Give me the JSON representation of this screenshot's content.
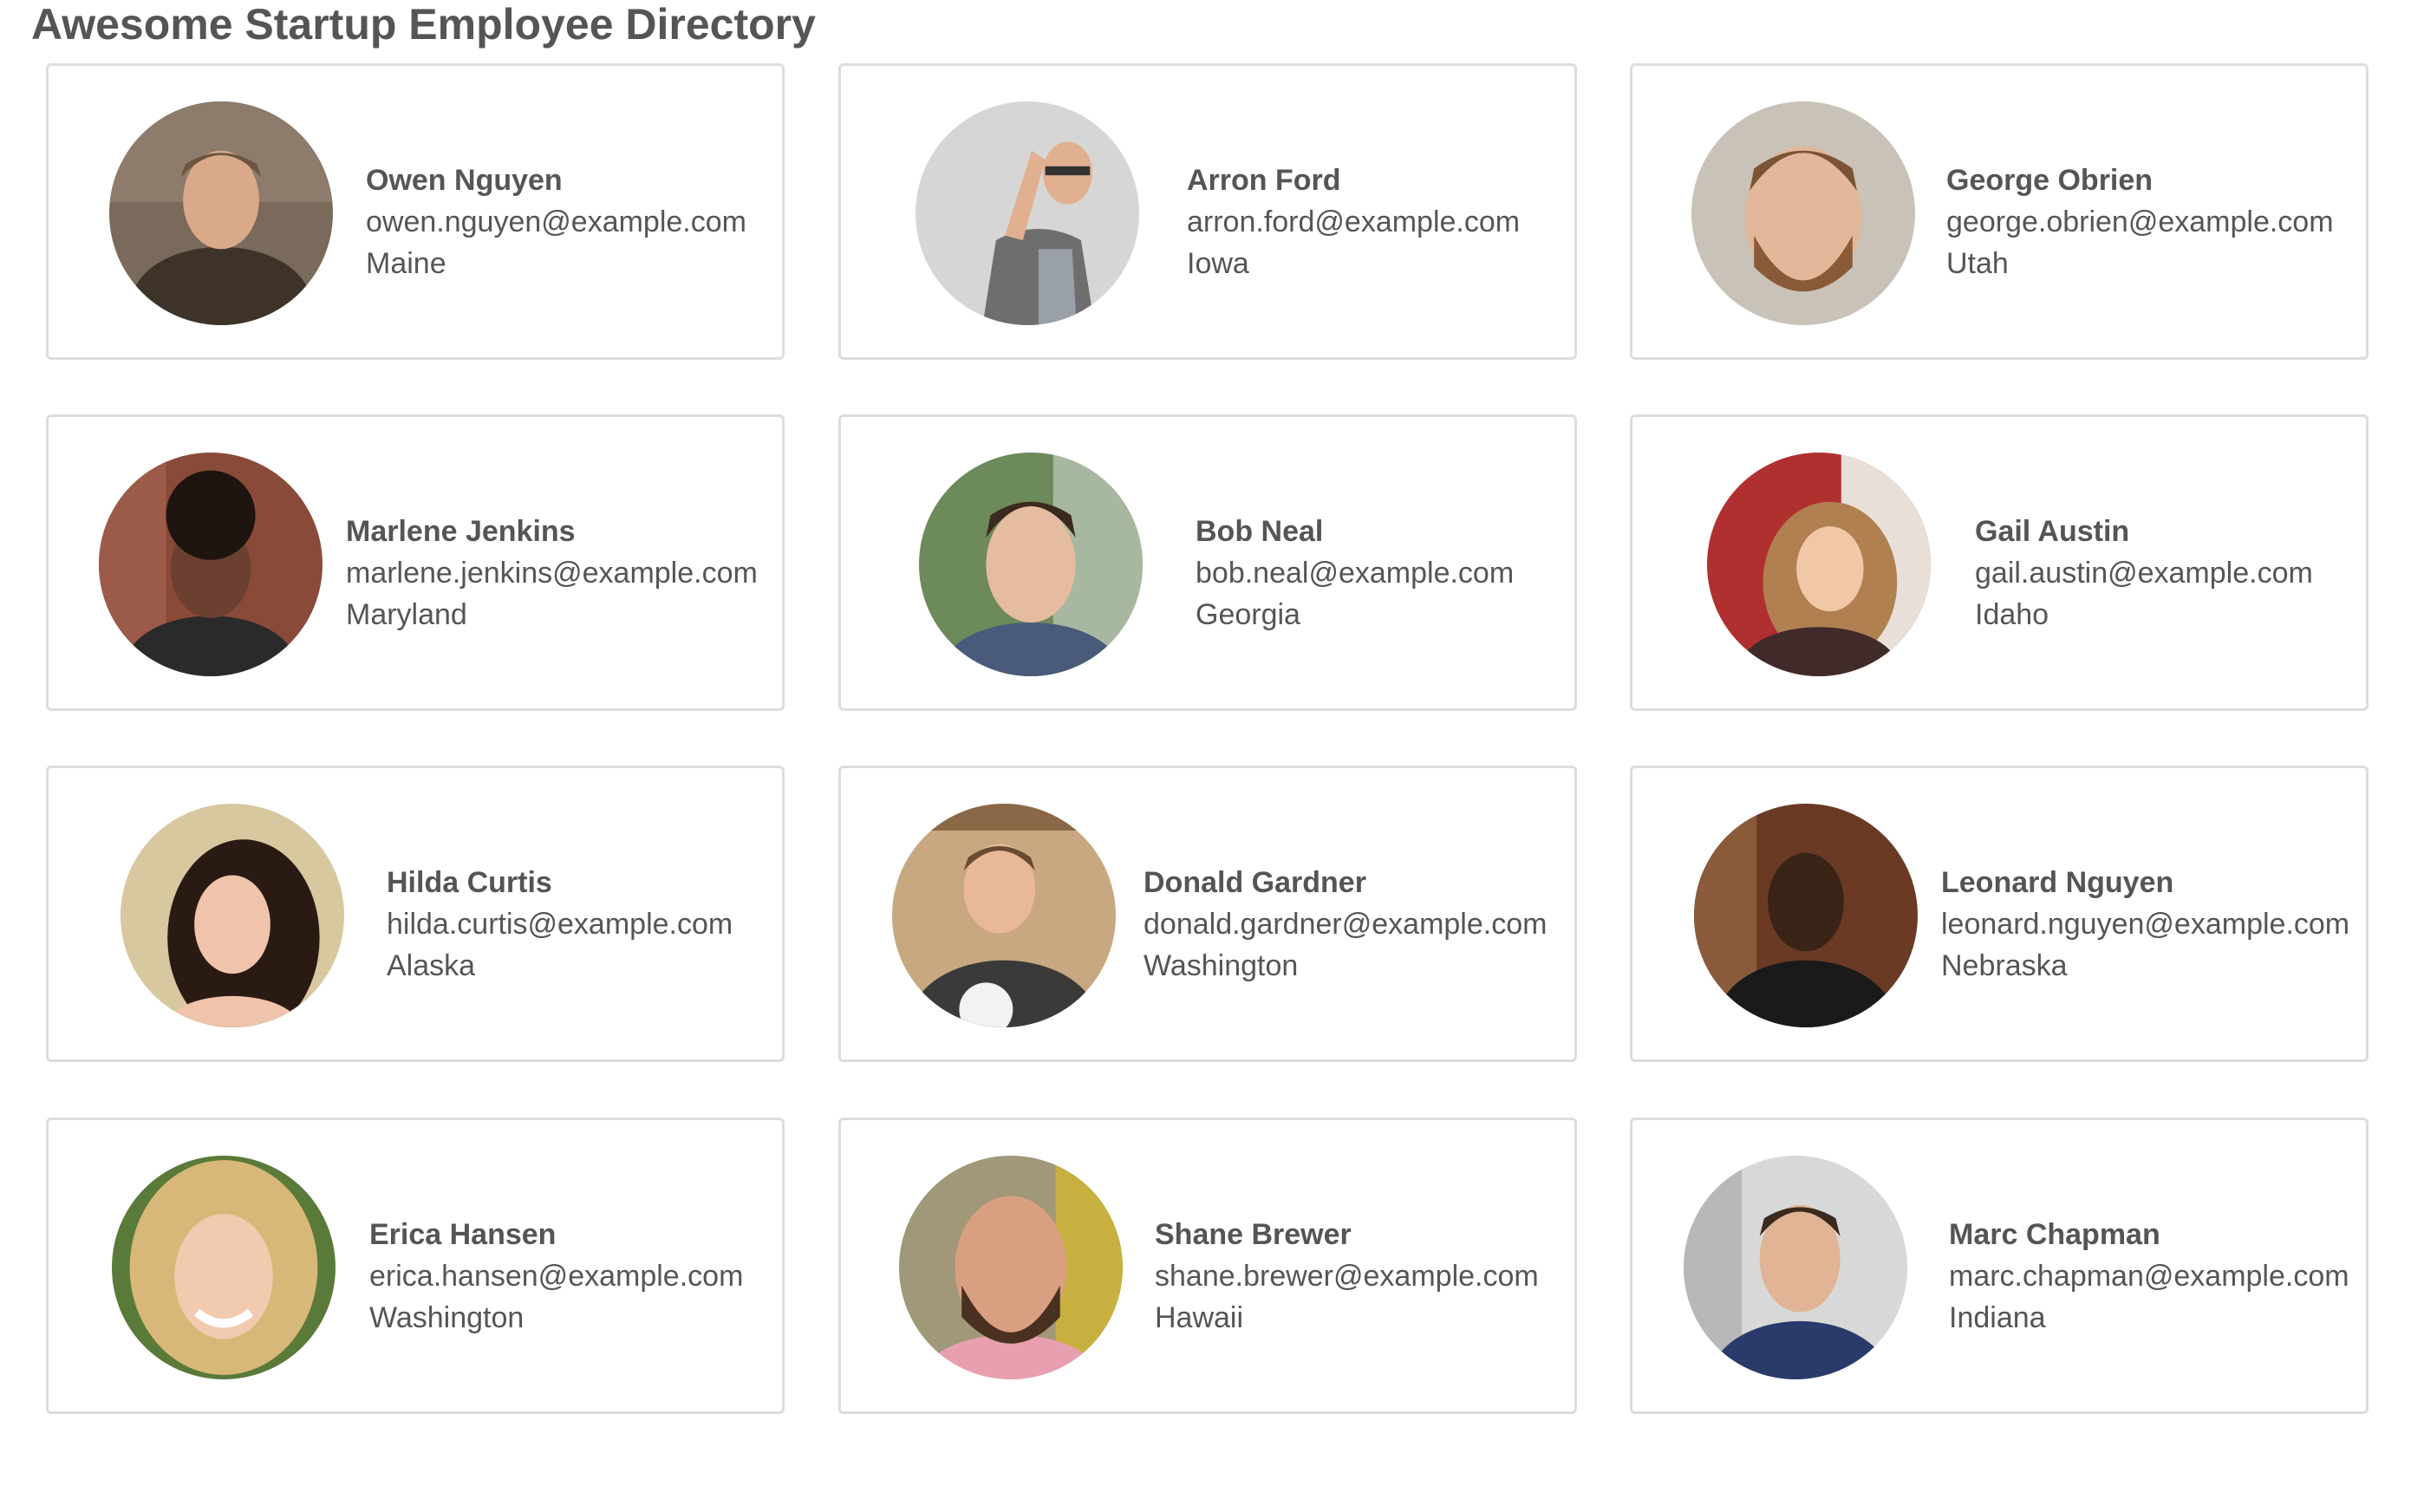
{
  "page": {
    "title": "Awesome Startup Employee Directory"
  },
  "employees": [
    {
      "name": "Owen Nguyen",
      "email": "owen.nguyen@example.com",
      "state": "Maine"
    },
    {
      "name": "Arron Ford",
      "email": "arron.ford@example.com",
      "state": "Iowa"
    },
    {
      "name": "George Obrien",
      "email": "george.obrien@example.com",
      "state": "Utah"
    },
    {
      "name": "Marlene Jenkins",
      "email": "marlene.jenkins@example.com",
      "state": "Maryland"
    },
    {
      "name": "Bob Neal",
      "email": "bob.neal@example.com",
      "state": "Georgia"
    },
    {
      "name": "Gail Austin",
      "email": "gail.austin@example.com",
      "state": "Idaho"
    },
    {
      "name": "Hilda Curtis",
      "email": "hilda.curtis@example.com",
      "state": "Alaska"
    },
    {
      "name": "Donald Gardner",
      "email": "donald.gardner@example.com",
      "state": "Washington"
    },
    {
      "name": "Leonard Nguyen",
      "email": "leonard.nguyen@example.com",
      "state": "Nebraska"
    },
    {
      "name": "Erica Hansen",
      "email": "erica.hansen@example.com",
      "state": "Washington"
    },
    {
      "name": "Shane Brewer",
      "email": "shane.brewer@example.com",
      "state": "Hawaii"
    },
    {
      "name": "Marc Chapman",
      "email": "marc.chapman@example.com",
      "state": "Indiana"
    }
  ],
  "colors": {
    "text": "#555555",
    "card_border": "#dddddd",
    "background": "#ffffff"
  }
}
